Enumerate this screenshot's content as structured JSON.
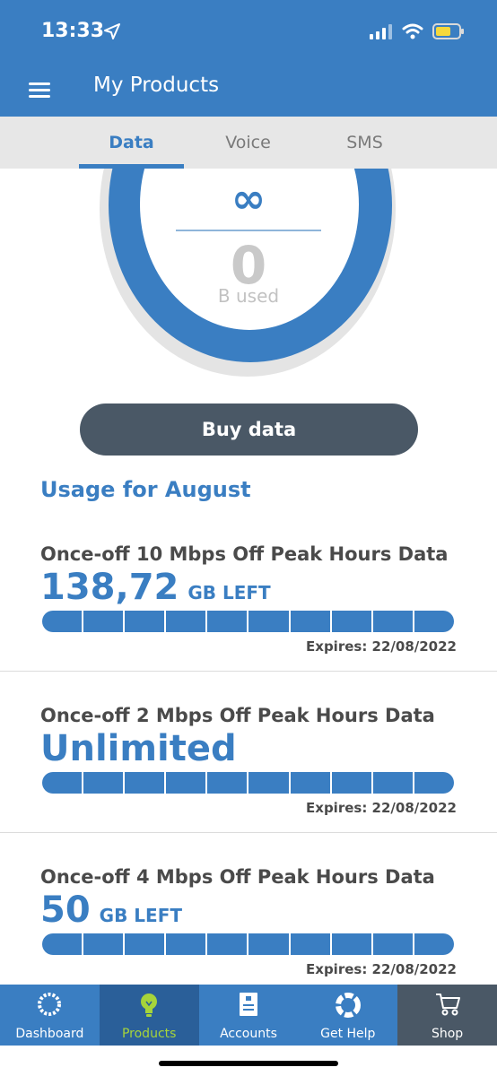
{
  "status_bar": {
    "time": "13:33"
  },
  "header": {
    "title": "My Products"
  },
  "tabs": [
    {
      "label": "Data",
      "active": true
    },
    {
      "label": "Voice",
      "active": false
    },
    {
      "label": "SMS",
      "active": false
    }
  ],
  "gauge": {
    "symbol": "∞",
    "used_value": "0",
    "used_label": "B used"
  },
  "buy_button": {
    "label": "Buy data"
  },
  "usage": {
    "title": "Usage for August",
    "products": [
      {
        "name": "Once-off 10 Mbps Off Peak Hours Data",
        "amount": "138,72",
        "unit": "GB LEFT",
        "expires": "Expires: 22/08/2022",
        "remaining_fraction": 1.0
      },
      {
        "name": "Once-off 2 Mbps Off Peak Hours Data",
        "amount": "Unlimited",
        "unit": "",
        "expires": "Expires: 22/08/2022",
        "remaining_fraction": 1.0
      },
      {
        "name": "Once-off 4 Mbps Off Peak Hours Data",
        "amount": "50",
        "unit": "GB LEFT",
        "expires": "Expires: 22/08/2022",
        "remaining_fraction": 1.0
      }
    ]
  },
  "bottom_nav": [
    {
      "label": "Dashboard",
      "icon": "dashboard-icon"
    },
    {
      "label": "Products",
      "icon": "lightbulb-icon",
      "active": true
    },
    {
      "label": "Accounts",
      "icon": "invoice-icon"
    },
    {
      "label": "Get Help",
      "icon": "lifebuoy-icon"
    },
    {
      "label": "Shop",
      "icon": "cart-icon"
    }
  ],
  "colors": {
    "brand_blue": "#3a7ec2",
    "dark_button": "#4a5866",
    "active_green": "#a6d43a"
  }
}
